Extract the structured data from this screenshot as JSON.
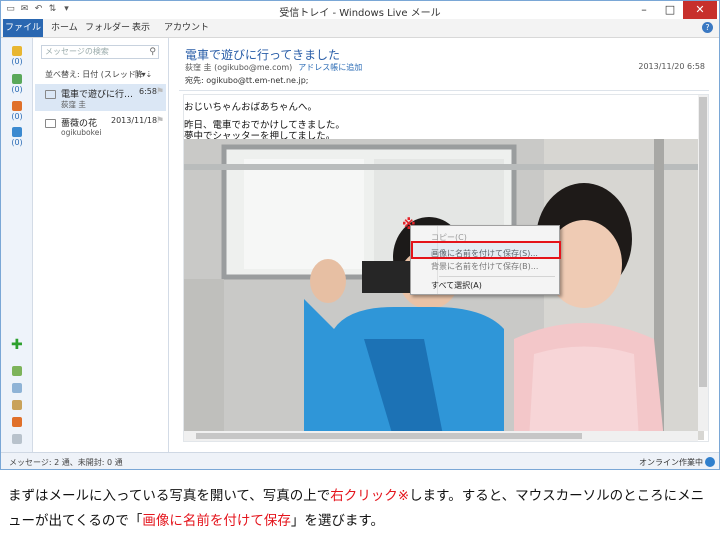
{
  "window": {
    "title": "受信トレイ - Windows Live メール",
    "controls": {
      "minimize": "–",
      "maximize": "□",
      "close": "✕"
    }
  },
  "ribbon": {
    "tabs": [
      "ファイル",
      "ホーム",
      "フォルダー",
      "表示",
      "アカウント"
    ],
    "help": "?"
  },
  "left_accounts": [
    {
      "count": "(0)",
      "color": "#e8b631"
    },
    {
      "count": "(0)",
      "color": "#5aa85a"
    },
    {
      "count": "(0)",
      "color": "#e0702a"
    },
    {
      "count": "(0)",
      "color": "#3c8ad0"
    }
  ],
  "message_list": {
    "search_placeholder": "メッセージの検索",
    "sort_label": "並べ替え: 日付 (スレッド)",
    "sort_dir": "降 ⇣",
    "items": [
      {
        "subject": "電車で遊びに行…",
        "date": "6:58",
        "from": "荻窪 圭"
      },
      {
        "subject": "薔薇の花",
        "date": "2013/11/18",
        "from": "ogikubokei"
      }
    ]
  },
  "reading": {
    "subject": "電車で遊びに行ってきました",
    "from": "荻窪 圭 (ogikubo@me.com)",
    "add_contact": "アドレス帳に追加",
    "date": "2013/11/20 6:58",
    "to": "宛先: ogikubo@tt.em-net.ne.jp;",
    "body_lines": [
      "おじいちゃんおばあちゃんへ。",
      "昨日、電車でおでかけしてきました。",
      "夢中でシャッターを押してました。"
    ]
  },
  "context_menu": {
    "marker": "※",
    "items": [
      "コピー(C)",
      "画像に名前を付けて保存(S)...",
      "背景に名前を付けて保存(B)...",
      "すべて選択(A)"
    ]
  },
  "status": {
    "left": "メッセージ: 2 通、未開封: 0 通",
    "right": "オンライン作業中"
  },
  "caption": {
    "part1": "まずはメールに入っている写真を開いて、写真の上で",
    "part2": "右クリック※",
    "part3": "します。すると、マウスカーソルのところにメニューが出てくるので「",
    "part4": "画像に名前を付けて保存",
    "part5": "」を選びます。"
  }
}
